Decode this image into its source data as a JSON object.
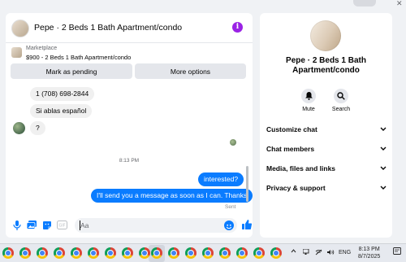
{
  "chat": {
    "title": "Pepe · 2 Beds 1 Bath Apartment/condo",
    "marketplace_label": "Marketplace",
    "marketplace_item": "$900 - 2 Beds 1 Bath Apartment/condo",
    "buttons": {
      "pending": "Mark as pending",
      "more": "More options"
    },
    "messages_in": [
      "1 (708) 698-2844",
      "Si ablas español",
      "?"
    ],
    "timestamp": "8:13 PM",
    "messages_out": [
      "interested?",
      "I'll send you a message as soon as I can. Thanks"
    ],
    "status": "Sent",
    "input_placeholder": "Aa"
  },
  "info_panel": {
    "title": "Pepe · 2 Beds 1 Bath Apartment/condo",
    "actions": [
      {
        "label": "Mute",
        "icon": "bell-icon"
      },
      {
        "label": "Search",
        "icon": "search-icon"
      }
    ],
    "sections": [
      "Customize chat",
      "Chat members",
      "Media, files and links",
      "Privacy & support"
    ]
  },
  "taskbar": {
    "language": "ENG",
    "time": "8:13 PM",
    "date": "8/7/2025"
  },
  "colors": {
    "accent": "#0a7cff",
    "info": "#9a22e5"
  }
}
